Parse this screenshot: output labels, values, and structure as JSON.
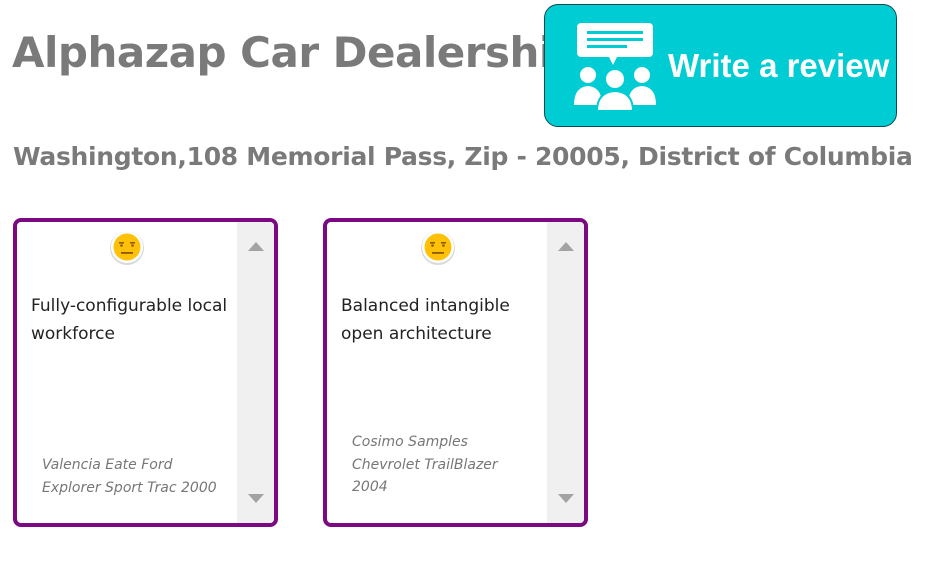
{
  "header": {
    "title": "Alphazap Car Dealership",
    "address": "Washington,108 Memorial Pass, Zip - 20005, District of Columbia"
  },
  "write_review_button": {
    "label": "Write a review",
    "icon": "people-comment-icon",
    "background_color": "#00ccd3"
  },
  "reviews": [
    {
      "sentiment_icon": "neutral-face-icon",
      "text": "Fully-configurable local workforce",
      "author_line1": "Valencia Eate Ford",
      "author_line2": "Explorer Sport Trac 2000",
      "author_line3": ""
    },
    {
      "sentiment_icon": "neutral-face-icon",
      "text": "Balanced intangible open architecture",
      "author_line1": "Cosimo Samples",
      "author_line2": "Chevrolet TrailBlazer",
      "author_line3": "2004"
    }
  ],
  "colors": {
    "card_border": "#7b0a82",
    "heading_text": "#7a7a7a",
    "face": "#ffc107"
  }
}
